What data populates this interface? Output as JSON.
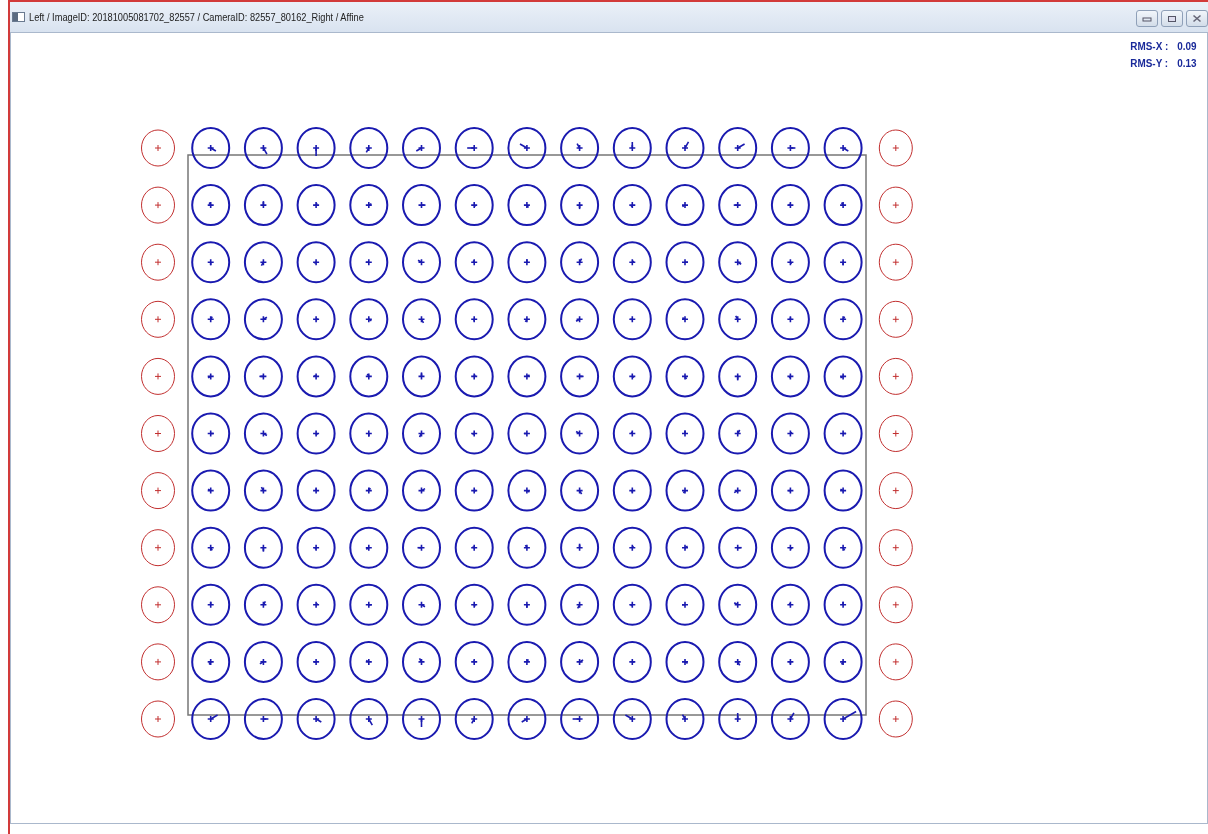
{
  "window": {
    "title": "Left / ImageID: 20181005081702_82557 / CameraID: 82557_80162_Right / Affine"
  },
  "rms": [
    {
      "label": "RMS-X :",
      "value": "0.09"
    },
    {
      "label": "RMS-Y :",
      "value": "0.13"
    }
  ]
}
